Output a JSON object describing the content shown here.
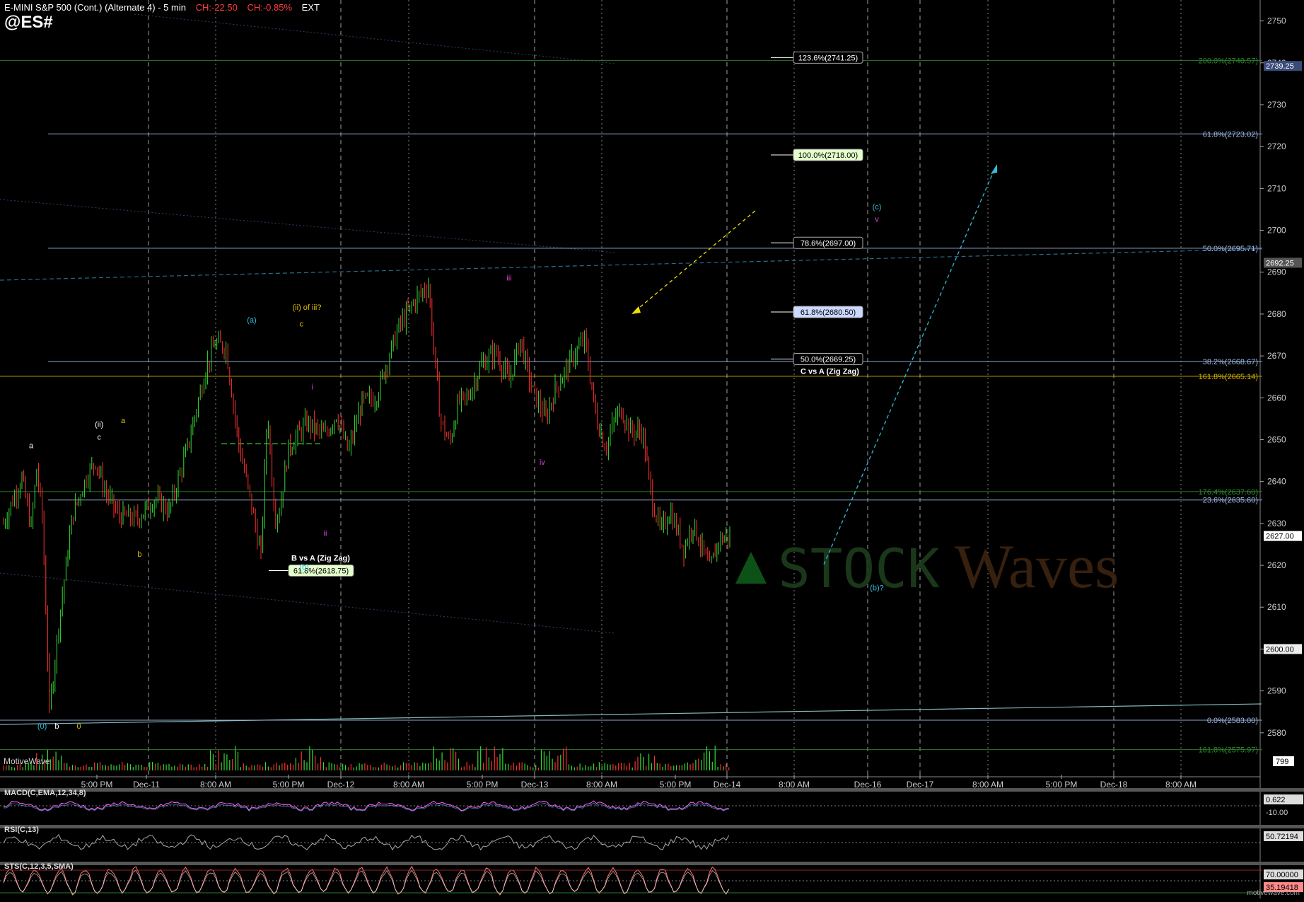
{
  "header": {
    "title": "E-MINI S&P 500 (Cont.) (Alternate 4) - 5 min",
    "change": "CH:-22.50",
    "change_pct": "CH:-0.85%",
    "session": "EXT",
    "symbol": "@ES#"
  },
  "watermark_provider": "MotiveWave",
  "brand_footer": "motivewave.com",
  "colors": {
    "up": "#33dd33",
    "down": "#ff3030",
    "grid": "#bbbbbb",
    "fib_blue": "#9fb8e8",
    "fib_green": "#2e8b2e",
    "fib_yellow": "#d8b400",
    "cyan": "#33bbdd",
    "macd": "#ff66ff",
    "price_badge": "#ffffff"
  },
  "chart_data": {
    "type": "candlestick",
    "interval": "5 min",
    "ylim": [
      2570,
      2755
    ],
    "y_ticks": [
      2580,
      2590,
      2600,
      2610,
      2620,
      2630,
      2640,
      2650,
      2660,
      2670,
      2680,
      2690,
      2700,
      2710,
      2720,
      2730,
      2740,
      2750
    ],
    "x_tick_labels": [
      "5:00 PM",
      "Dec-11",
      "8:00 AM",
      "5:00 PM",
      "Dec-12",
      "8:00 AM",
      "5:00 PM",
      "Dec-13",
      "8:00 AM",
      "5:00 PM",
      "Dec-14",
      "8:00 AM",
      "Dec-16",
      "Dec-17",
      "8:00 AM",
      "5:00 PM",
      "Dec-18",
      "8:00 AM"
    ],
    "price_path": [
      [
        0,
        2630
      ],
      [
        0.2,
        2641
      ],
      [
        0.3,
        2629
      ],
      [
        0.36,
        2643
      ],
      [
        0.42,
        2632
      ],
      [
        0.47,
        2604
      ],
      [
        0.5,
        2585
      ],
      [
        0.6,
        2606
      ],
      [
        0.75,
        2632
      ],
      [
        0.9,
        2641
      ],
      [
        1.0,
        2645
      ],
      [
        1.1,
        2638
      ],
      [
        1.25,
        2632
      ],
      [
        1.45,
        2631
      ],
      [
        1.65,
        2636
      ],
      [
        1.8,
        2633
      ],
      [
        2.0,
        2648
      ],
      [
        2.2,
        2667
      ],
      [
        2.3,
        2673
      ],
      [
        2.42,
        2672
      ],
      [
        2.55,
        2650
      ],
      [
        2.7,
        2634
      ],
      [
        2.8,
        2622
      ],
      [
        2.87,
        2657
      ],
      [
        2.95,
        2632
      ],
      [
        3.0,
        2633
      ],
      [
        3.1,
        2648
      ],
      [
        3.3,
        2654
      ],
      [
        3.5,
        2651
      ],
      [
        3.62,
        2656
      ],
      [
        3.75,
        2647
      ],
      [
        3.9,
        2659
      ],
      [
        4.05,
        2660
      ],
      [
        4.15,
        2667
      ],
      [
        4.3,
        2677
      ],
      [
        4.5,
        2684
      ],
      [
        4.62,
        2687
      ],
      [
        4.75,
        2655
      ],
      [
        4.85,
        2649
      ],
      [
        4.95,
        2659
      ],
      [
        5.05,
        2660
      ],
      [
        5.2,
        2668
      ],
      [
        5.35,
        2671
      ],
      [
        5.5,
        2664
      ],
      [
        5.62,
        2674
      ],
      [
        5.75,
        2662
      ],
      [
        5.9,
        2655
      ],
      [
        6.0,
        2662
      ],
      [
        6.2,
        2670
      ],
      [
        6.32,
        2674
      ],
      [
        6.45,
        2655
      ],
      [
        6.55,
        2648
      ],
      [
        6.65,
        2655
      ],
      [
        6.72,
        2657
      ],
      [
        6.82,
        2652
      ],
      [
        6.95,
        2652
      ],
      [
        7.05,
        2636
      ],
      [
        7.15,
        2628
      ],
      [
        7.25,
        2633
      ],
      [
        7.4,
        2624
      ],
      [
        7.5,
        2630
      ],
      [
        7.6,
        2624
      ],
      [
        7.68,
        2619
      ],
      [
        7.78,
        2626
      ],
      [
        7.9,
        2627
      ]
    ],
    "fib_right_labels": [
      {
        "label": "200.0%(2740.57)",
        "value": 2740.57,
        "color": "fib_green"
      },
      {
        "label": "61.8%(2723.02)",
        "value": 2723.02,
        "color": "fib_blue"
      },
      {
        "label": "50.0%(2695.71)",
        "value": 2695.71,
        "color": "fib_blue"
      },
      {
        "label": "38.2%(2668.67)",
        "value": 2668.67,
        "color": "fib_blue"
      },
      {
        "label": "161.8%(2665.14)",
        "value": 2665.14,
        "color": "fib_yellow"
      },
      {
        "label": "176.4%(2637.60)",
        "value": 2637.6,
        "color": "fib_green"
      },
      {
        "label": "23.6%(2635.60)",
        "value": 2635.6,
        "color": "fib_blue"
      },
      {
        "label": "0.0%(2583.00)",
        "value": 2583.0,
        "color": "fib_blue"
      },
      {
        "label": "161.8%(2575.97)",
        "value": 2575.97,
        "color": "fib_green"
      }
    ],
    "fib_projection_labels": [
      {
        "label": "123.6%(2741.25)",
        "value": 2741.25,
        "box": "#000000",
        "fg": "#ffffff"
      },
      {
        "label": "100.0%(2718.00)",
        "value": 2718.0,
        "box": "#e4ffcc",
        "fg": "#000000"
      },
      {
        "label": "78.6%(2697.00)",
        "value": 2697.0,
        "box": "#000000",
        "fg": "#ffffff"
      },
      {
        "label": "61.8%(2680.50)",
        "value": 2680.5,
        "box": "#ccd8ff",
        "fg": "#000000"
      },
      {
        "label": "50.0%(2669.25)",
        "value": 2669.25,
        "box": "#000000",
        "fg": "#ffffff"
      }
    ],
    "fib_projection_title": "C vs A (Zig Zag)",
    "b_projection_title": "B vs A (Zig Zag)",
    "b_projection_label": "61.8%(2618.75)",
    "b_projection_value": 2618.75,
    "price_badges": [
      {
        "label": "2739.25",
        "value": 2739.25,
        "bg": "#3a4a7a",
        "fg": "#ffffff"
      },
      {
        "label": "2692.25",
        "value": 2692.25,
        "bg": "#555555",
        "fg": "#ffffff"
      },
      {
        "label": "2627.00",
        "value": 2627.0,
        "bg": "#ffffff",
        "fg": "#000000"
      },
      {
        "label": "2600.00",
        "value": 2600.0,
        "bg": "#eeeeee",
        "fg": "#000000"
      }
    ],
    "volume_badge": "799",
    "wave_labels": [
      {
        "text": "a",
        "t": 0.3,
        "v": 2648,
        "color": "#ffffff"
      },
      {
        "text": "(ii)",
        "t": 1.04,
        "v": 2653,
        "color": "#ffffff"
      },
      {
        "text": "c",
        "t": 1.04,
        "v": 2650,
        "color": "#ffffff"
      },
      {
        "text": "a",
        "t": 1.3,
        "v": 2654,
        "color": "#e0c000"
      },
      {
        "text": "b",
        "t": 1.48,
        "v": 2622,
        "color": "#e0c000"
      },
      {
        "text": "(0)",
        "t": 0.42,
        "v": 2581,
        "color": "#33bbdd"
      },
      {
        "text": "b",
        "t": 0.58,
        "v": 2581,
        "color": "#ffffff"
      },
      {
        "text": "0",
        "t": 0.82,
        "v": 2581,
        "color": "#e0c000"
      },
      {
        "text": "(a)",
        "t": 2.7,
        "v": 2678,
        "color": "#33bbdd"
      },
      {
        "text": "(ii) of iii?",
        "t": 3.3,
        "v": 2681,
        "color": "#e0c000"
      },
      {
        "text": "c",
        "t": 3.24,
        "v": 2677,
        "color": "#e0c000"
      },
      {
        "text": "i",
        "t": 3.36,
        "v": 2662,
        "color": "#dd44dd"
      },
      {
        "text": "ii",
        "t": 3.5,
        "v": 2627,
        "color": "#dd44dd"
      },
      {
        "text": "(b)",
        "t": 3.27,
        "v": 2619,
        "color": "#33bbdd"
      },
      {
        "text": "iii",
        "t": 5.5,
        "v": 2688,
        "color": "#dd44dd"
      },
      {
        "text": "iv",
        "t": 5.86,
        "v": 2644,
        "color": "#dd44dd"
      },
      {
        "text": "(c)",
        "t": 9.5,
        "v": 2705,
        "color": "#33bbdd"
      },
      {
        "text": "v",
        "t": 9.5,
        "v": 2702,
        "color": "#dd44dd"
      },
      {
        "text": "(b)?",
        "t": 9.5,
        "v": 2614,
        "color": "#33bbdd"
      }
    ],
    "indicators": [
      {
        "name": "MACD(C,EMA,12,34,8)",
        "value_label": "0.622",
        "second_label": "-10.00"
      },
      {
        "name": "RSI(C,13)",
        "value_label": "50.72194"
      },
      {
        "name": "STS(C,12,3,5,SMA)",
        "value_label": "70.00000",
        "second_label": "35.19418"
      }
    ],
    "watermark": "STOCKWaves"
  }
}
